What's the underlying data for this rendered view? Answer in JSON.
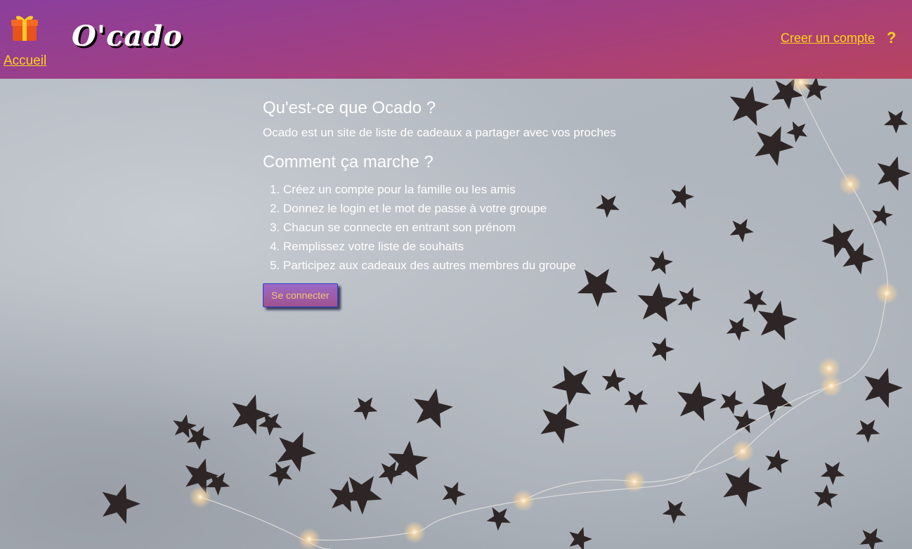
{
  "header": {
    "brand": "O'cado",
    "home_label": "Accueil",
    "signup_label": "Creer un compte",
    "help_label": "?"
  },
  "intro": {
    "title": "Qu'est-ce que Ocado ?",
    "description": "Ocado est un site de liste de cadeaux a partager avec vos proches"
  },
  "how": {
    "title": "Comment ça marche ?",
    "steps": [
      "Créez un compte pour la famille ou les amis",
      "Donnez le login et le mot de passe à votre groupe",
      "Chacun se connecte en entrant son prénom",
      "Remplissez votre liste de souhaits",
      "Participez aux cadeaux des autres membres du groupe"
    ]
  },
  "login_button": "Se connecter",
  "colors": {
    "link": "#ffd21f",
    "header_start": "#8a3f9c",
    "header_end": "#b8435f",
    "button_text": "#f4c27a"
  }
}
